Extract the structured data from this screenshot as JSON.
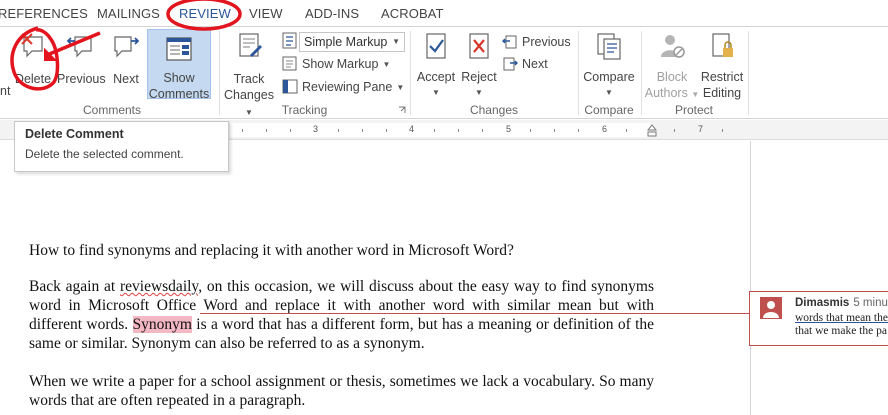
{
  "tabs": [
    {
      "label": "REFERENCES",
      "active": false
    },
    {
      "label": "MAILINGS",
      "active": false
    },
    {
      "label": "REVIEW",
      "active": true
    },
    {
      "label": "VIEW",
      "active": false
    },
    {
      "label": "ADD-INS",
      "active": false
    },
    {
      "label": "ACROBAT",
      "active": false
    }
  ],
  "ribbon": {
    "groups": {
      "comments": "Comments",
      "tracking": "Tracking",
      "changes": "Changes",
      "compare": "Compare",
      "protect": "Protect"
    },
    "comments": {
      "cut_label": "nt",
      "delete_label": "Delete",
      "previous_label": "Previous",
      "next_label": "Next",
      "show_comments_line1": "Show",
      "show_comments_line2": "Comments"
    },
    "tracking": {
      "track_changes_line1": "Track",
      "track_changes_line2": "Changes",
      "markup_combo_value": "Simple Markup",
      "show_markup_label": "Show Markup",
      "reviewing_pane_label": "Reviewing Pane"
    },
    "changes": {
      "accept_label": "Accept",
      "reject_label": "Reject",
      "previous_label": "Previous",
      "next_label": "Next"
    },
    "compare": {
      "compare_label": "Compare"
    },
    "protect": {
      "block_authors_line1": "Block",
      "block_authors_line2": "Authors",
      "restrict_editing_line1": "Restrict",
      "restrict_editing_line2": "Editing"
    }
  },
  "ruler": {
    "numbers": [
      "3",
      "4",
      "5",
      "6",
      "7"
    ]
  },
  "tooltip": {
    "title": "Delete Comment",
    "description": "Delete the selected comment."
  },
  "document": {
    "title": "How to find synonyms and replacing it with another word in Microsoft Word?",
    "p1_before_link": "Back again at ",
    "p1_link": "reviewsdaily",
    "p1_rest": ", on this occasion, we will discuss about the easy way to find synonyms word in Microsoft Office Word and replace it with another word with similar mean but with different words. ",
    "p1_highlight": "Synonym",
    "p1_end": " is a word that has a different form, but has a meaning or definition of the same or similar. Synonym can also be referred to as a synonym.",
    "p2": "When we write a paper for a school assignment or thesis, sometimes we lack a vocabulary. So many words that are often repeated in a paragraph."
  },
  "comment": {
    "author": "Dimasmis",
    "time": "5 minu",
    "line1": "words that mean the",
    "line2": "that we make the pa"
  },
  "colors": {
    "accent": "#2b579a",
    "selected_button": "#c5d9f1",
    "comment_red": "#c0504d",
    "annotation_red": "#e3141e",
    "highlight": "#f4b8c4"
  }
}
